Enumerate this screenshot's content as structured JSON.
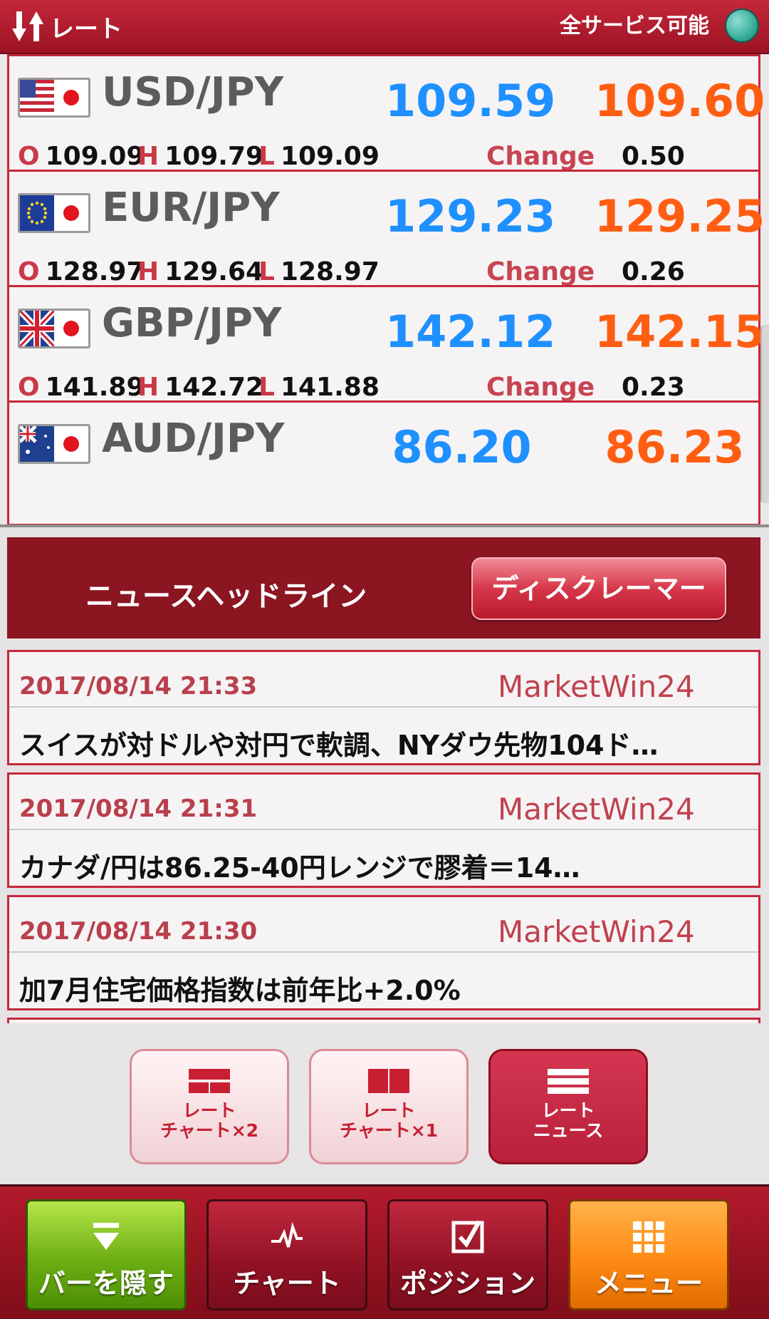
{
  "header": {
    "title": "レート",
    "status": "全サービス可能",
    "status_color": "#2aa391"
  },
  "rates": [
    {
      "pair": "USD/JPY",
      "bid": "109.59",
      "ask": "109.60",
      "o_label": "O",
      "open": "109.09",
      "h_label": "H",
      "high": "109.79",
      "l_label": "L",
      "low": "109.09",
      "change_label": "Change",
      "change": "0.50"
    },
    {
      "pair": "EUR/JPY",
      "bid": "129.23",
      "ask": "129.25",
      "o_label": "O",
      "open": "128.97",
      "h_label": "H",
      "high": "129.64",
      "l_label": "L",
      "low": "128.97",
      "change_label": "Change",
      "change": "0.26"
    },
    {
      "pair": "GBP/JPY",
      "bid": "142.12",
      "ask": "142.15",
      "o_label": "O",
      "open": "141.89",
      "h_label": "H",
      "high": "142.72",
      "l_label": "L",
      "low": "141.88",
      "change_label": "Change",
      "change": "0.23"
    },
    {
      "pair": "AUD/JPY",
      "bid": "86.20",
      "ask": "86.23"
    }
  ],
  "news_header": {
    "title": "ニュースヘッドライン",
    "disclaimer_button": "ディスクレーマー"
  },
  "news": [
    {
      "datetime": "2017/08/14 21:33",
      "source": "MarketWin24",
      "headline": "スイスが対ドルや対円で軟調、NYダウ先物104ド…"
    },
    {
      "datetime": "2017/08/14 21:31",
      "source": "MarketWin24",
      "headline": "カナダ/円は86.25-40円レンジで膠着＝14…"
    },
    {
      "datetime": "2017/08/14 21:30",
      "source": "MarketWin24",
      "headline": "加7月住宅価格指数は前年比+2.0%"
    }
  ],
  "layout_buttons": [
    {
      "line1": "レート",
      "line2": "チャート×2",
      "icon": "layout-two-rows-icon",
      "active": false
    },
    {
      "line1": "レート",
      "line2": "チャート×1",
      "icon": "layout-two-columns-icon",
      "active": false
    },
    {
      "line1": "レート",
      "line2": "ニュース",
      "icon": "layout-list-icon",
      "active": true
    }
  ],
  "tabbar": {
    "hide_bar": "バーを隠す",
    "chart": "チャート",
    "position": "ポジション",
    "menu": "メニュー"
  },
  "colors": {
    "brand_red": "#c5283a",
    "bid_blue": "#1e90ff",
    "ask_orange": "#ff5e12",
    "green_tab": "#6cae12",
    "orange_tab": "#ff8a14"
  }
}
